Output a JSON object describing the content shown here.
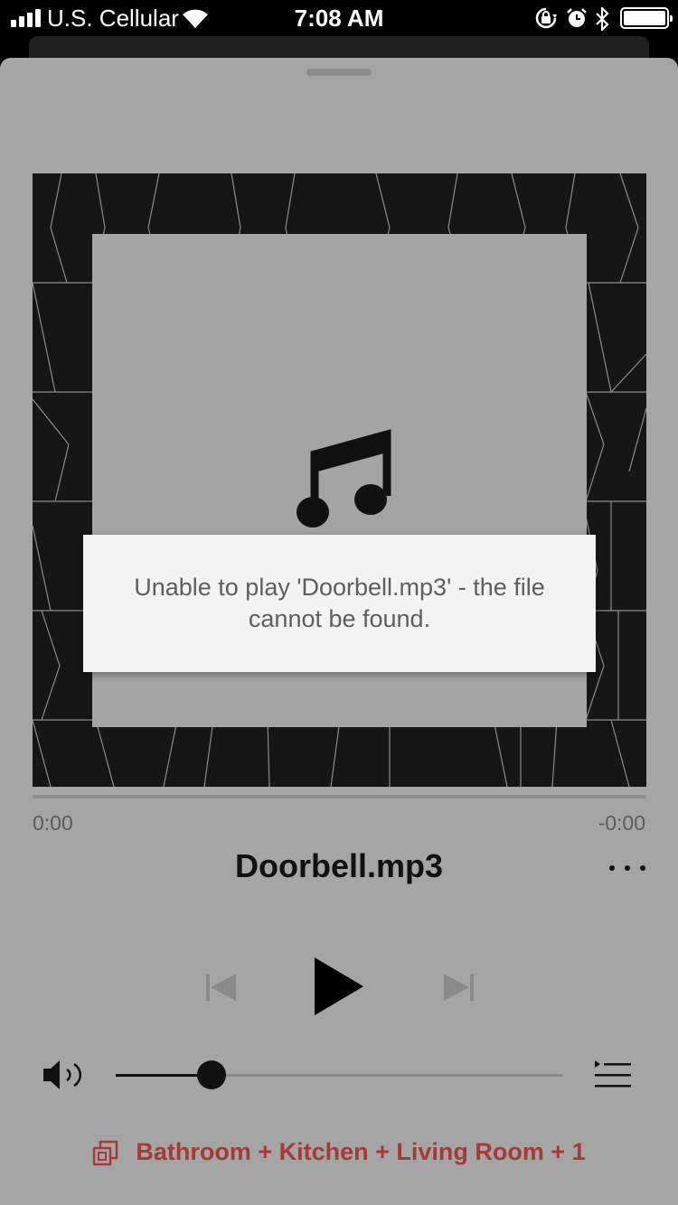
{
  "status_bar": {
    "carrier": "U.S. Cellular",
    "time": "7:08 AM",
    "icons": [
      "signal-icon",
      "wifi-icon",
      "orientation-lock-icon",
      "alarm-icon",
      "bluetooth-icon",
      "battery-icon"
    ]
  },
  "now_playing": {
    "artwork_icon": "music-note-icon",
    "error_message": "Unable to play 'Doorbell.mp3' - the file cannot be found.",
    "elapsed": "0:00",
    "remaining": "-0:00",
    "progress": 0,
    "title": "Doorbell.mp3",
    "more_icon": "more-icon"
  },
  "controls": {
    "previous_icon": "previous-icon",
    "play_icon": "play-icon",
    "next_icon": "next-icon",
    "volume_icon": "volume-icon",
    "queue_icon": "queue-icon",
    "volume_level": 0.215
  },
  "rooms": {
    "icon": "rooms-group-icon",
    "label": "Bathroom + Kitchen + Living Room + 1"
  },
  "colors": {
    "sheet_background": "#a5a5a5",
    "accent": "#a53a36",
    "artwork_background": "#161616",
    "toast_background": "#f3f3f3"
  }
}
